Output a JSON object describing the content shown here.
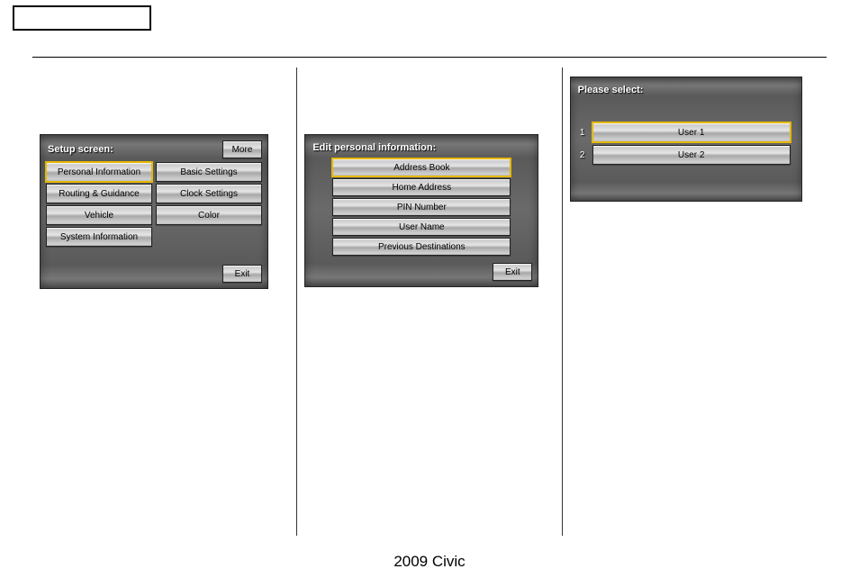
{
  "footer": "2009  Civic",
  "setup": {
    "title": "Setup screen:",
    "more": "More",
    "exit": "Exit",
    "items": [
      {
        "label": "Personal Information",
        "selected": true
      },
      {
        "label": "Basic Settings",
        "selected": false
      },
      {
        "label": "Routing & Guidance",
        "selected": false
      },
      {
        "label": "Clock Settings",
        "selected": false
      },
      {
        "label": "Vehicle",
        "selected": false
      },
      {
        "label": "Color",
        "selected": false
      },
      {
        "label": "System Information",
        "selected": false
      }
    ]
  },
  "epi": {
    "title": "Edit personal information:",
    "exit": "Exit",
    "items": [
      {
        "label": "Address Book",
        "selected": true
      },
      {
        "label": "Home Address",
        "selected": false
      },
      {
        "label": "PIN Number",
        "selected": false
      },
      {
        "label": "User Name",
        "selected": false
      },
      {
        "label": "Previous Destinations",
        "selected": false
      }
    ]
  },
  "ps": {
    "title": "Please select:",
    "items": [
      {
        "num": "1",
        "label": "User 1",
        "selected": true
      },
      {
        "num": "2",
        "label": "User 2",
        "selected": false
      }
    ]
  }
}
